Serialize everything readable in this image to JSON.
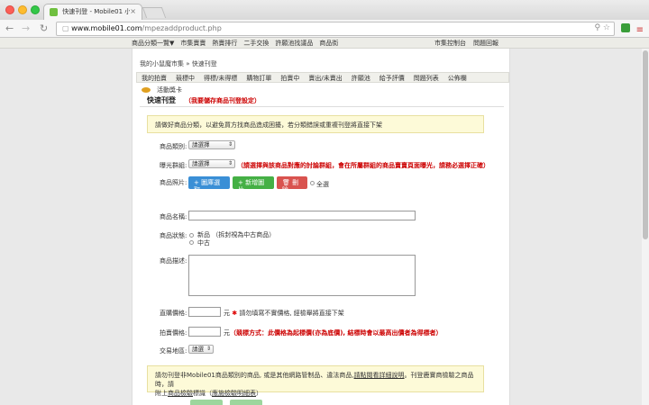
{
  "browser": {
    "tab_title": "快速刊登 - Mobile01 小廚魔",
    "tab_close": "×",
    "url_host": "www.mobile01.com",
    "url_path": "/mpezaddproduct.php"
  },
  "sitenav": {
    "items": [
      "商品分類一覽▼",
      "市集賣賣",
      "熱賣排行",
      "二手交換",
      "許願池找議品",
      "商品街"
    ],
    "right": [
      "市集控制台",
      "問題回報"
    ]
  },
  "breadcrumb": "我的小鼠魔市集 » 快速刊登",
  "tabs": [
    "我的拍賣",
    "競標中",
    "得標/未得標",
    "購物訂單",
    "拍賣中",
    "賣出/未賣出",
    "許願池",
    "給予評價",
    "問題列表",
    "公佈欄",
    "活動獎卡"
  ],
  "heading": "快速刊登",
  "heading_note": "（我要儲存商品刊登設定）",
  "notice": "請做好商品分類，以避免買方找商品造成困擾，若分類錯誤或重複刊登將直接下架",
  "form": {
    "category_label": "商品類別:",
    "category_value": "請選擇",
    "group_label": "曝光群組:",
    "group_value": "請選擇",
    "group_warning": "（請選擇與該商品對應的討論群組，會在所屬群組的商品賣賣頁面曝光，請務必選擇正確）",
    "photo_label": "商品照片:",
    "btn_upload": "+ 圖庫選取",
    "btn_new": "+ 新增圖片",
    "btn_delete": "刪除",
    "select_all": "全選",
    "name_label": "商品名稱:",
    "status_label": "商品狀態:",
    "status_new": "新品 （拆封視為中古商品）",
    "status_used": "中古",
    "desc_label": "商品描述:",
    "buy_price_label": "直購價格:",
    "buy_price_unit": "元",
    "buy_price_note": "請勿填寫不實價格, 經檢舉將直接下架",
    "bid_price_label": "拍賣價格:",
    "bid_price_unit": "元",
    "bid_price_note": "（競標方式：此價格為起標價(亦為底價), 結標時會以最高出價者為得標者）",
    "region_label": "交易地區:",
    "region_value": "請選"
  },
  "bottom_notice_1": "請勿刊登非Mobile01商品類別的商品, 或是其他網路管制品、違法商品,",
  "bottom_notice_link": "請點閱看詳細說明",
  "bottom_notice_2": "。刊登鹿實商檢驗之商品時，請",
  "bottom_notice_3": "附上",
  "bottom_notice_link2": "商品檢驗",
  "bottom_notice_4": "標識（",
  "bottom_notice_link3": "應施檢驗明細表",
  "bottom_notice_5": "）"
}
